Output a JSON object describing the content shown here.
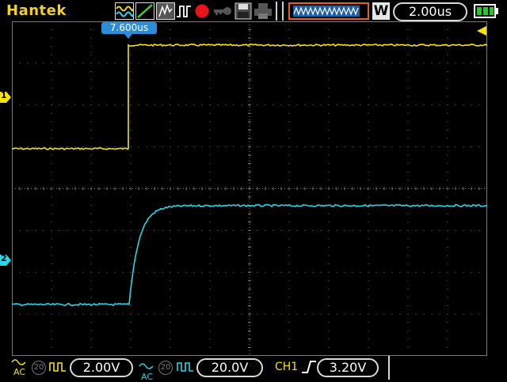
{
  "header": {
    "brand": "Hantek",
    "timebase_mode": "W",
    "timebase": "2.00us"
  },
  "trigger_time_label": "7.600us",
  "channel_markers": {
    "ch1": "1",
    "ch2": "2"
  },
  "footer": {
    "ch1": {
      "coupling": "AC",
      "probe": "20",
      "volts_div": "2.00V"
    },
    "ch2": {
      "coupling": "AC",
      "probe": "20",
      "volts_div": "20.0V"
    },
    "trigger": {
      "source": "CH1",
      "slope": "rising",
      "level": "3.20V"
    }
  },
  "colors": {
    "ch1": "#f5e20f",
    "ch2": "#27d7e8",
    "grid": "#7a7a7a",
    "accent_blue": "#2e8bd8"
  },
  "icons": [
    "wave-icon",
    "trend-icon",
    "fft-icon",
    "pulse-icon",
    "record-icon",
    "key-icon",
    "save-icon",
    "printer-icon",
    "run-waveform-icon",
    "battery-icon"
  ]
}
